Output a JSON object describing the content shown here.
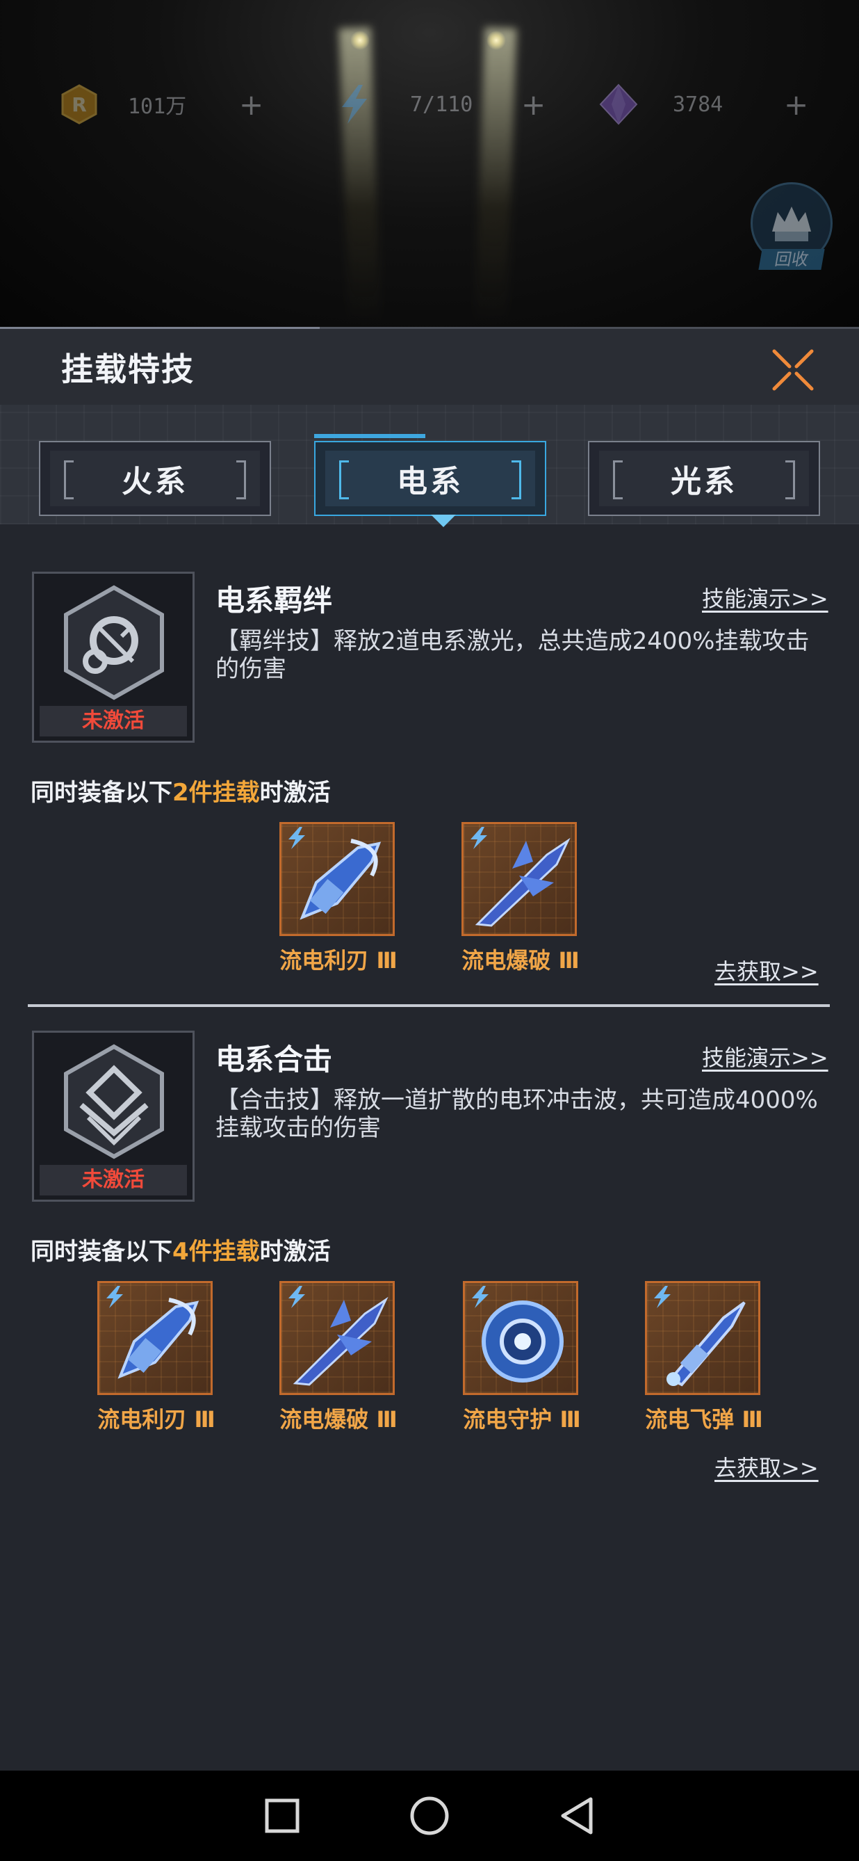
{
  "hud": {
    "coin": {
      "value": "101万",
      "plus": "+",
      "icon": "coin-r-icon"
    },
    "energy": {
      "value": "7/110",
      "plus": "+",
      "icon": "lightning-icon"
    },
    "gem": {
      "value": "3784",
      "plus": "+",
      "icon": "purple-gem-icon"
    },
    "recycle_label": "回收"
  },
  "panel": {
    "title": "挂载特技",
    "close_icon": "close-x-icon"
  },
  "tabs": [
    {
      "label": "火系",
      "selected": false
    },
    {
      "label": "电系",
      "selected": true
    },
    {
      "label": "光系",
      "selected": false
    }
  ],
  "skills": [
    {
      "title": "电系羁绊",
      "demo_link": "技能演示>>",
      "status": "未激活",
      "description": "【羁绊技】释放2道电系激光，总共造成2400%挂载攻击的伤害",
      "activate_prefix": "同时装备以下",
      "activate_highlight": "2件挂载",
      "activate_suffix": "时激活",
      "items": [
        {
          "name": "流电利刃 Ⅲ",
          "icon": "blade-weapon-icon"
        },
        {
          "name": "流电爆破 Ⅲ",
          "icon": "blast-weapon-icon"
        }
      ],
      "get_link": "去获取>>"
    },
    {
      "title": "电系合击",
      "demo_link": "技能演示>>",
      "status": "未激活",
      "description": "【合击技】释放一道扩散的电环冲击波，共可造成4000%挂载攻击的伤害",
      "activate_prefix": "同时装备以下",
      "activate_highlight": "4件挂载",
      "activate_suffix": "时激活",
      "items": [
        {
          "name": "流电利刃 Ⅲ",
          "icon": "blade-weapon-icon"
        },
        {
          "name": "流电爆破 Ⅲ",
          "icon": "blast-weapon-icon"
        },
        {
          "name": "流电守护 Ⅲ",
          "icon": "shield-weapon-icon"
        },
        {
          "name": "流电飞弹 Ⅲ",
          "icon": "missile-weapon-icon"
        }
      ],
      "get_link": "去获取>>"
    }
  ],
  "colors": {
    "panel_bg": "#23262d",
    "accent_blue": "#3ea7df",
    "highlight_orange": "#f3a73a",
    "inactive_red": "#f04a3a",
    "item_name": "#f1a648"
  },
  "navbar": {
    "recent_icon": "square-recents-icon",
    "home_icon": "circle-home-icon",
    "back_icon": "triangle-back-icon"
  }
}
